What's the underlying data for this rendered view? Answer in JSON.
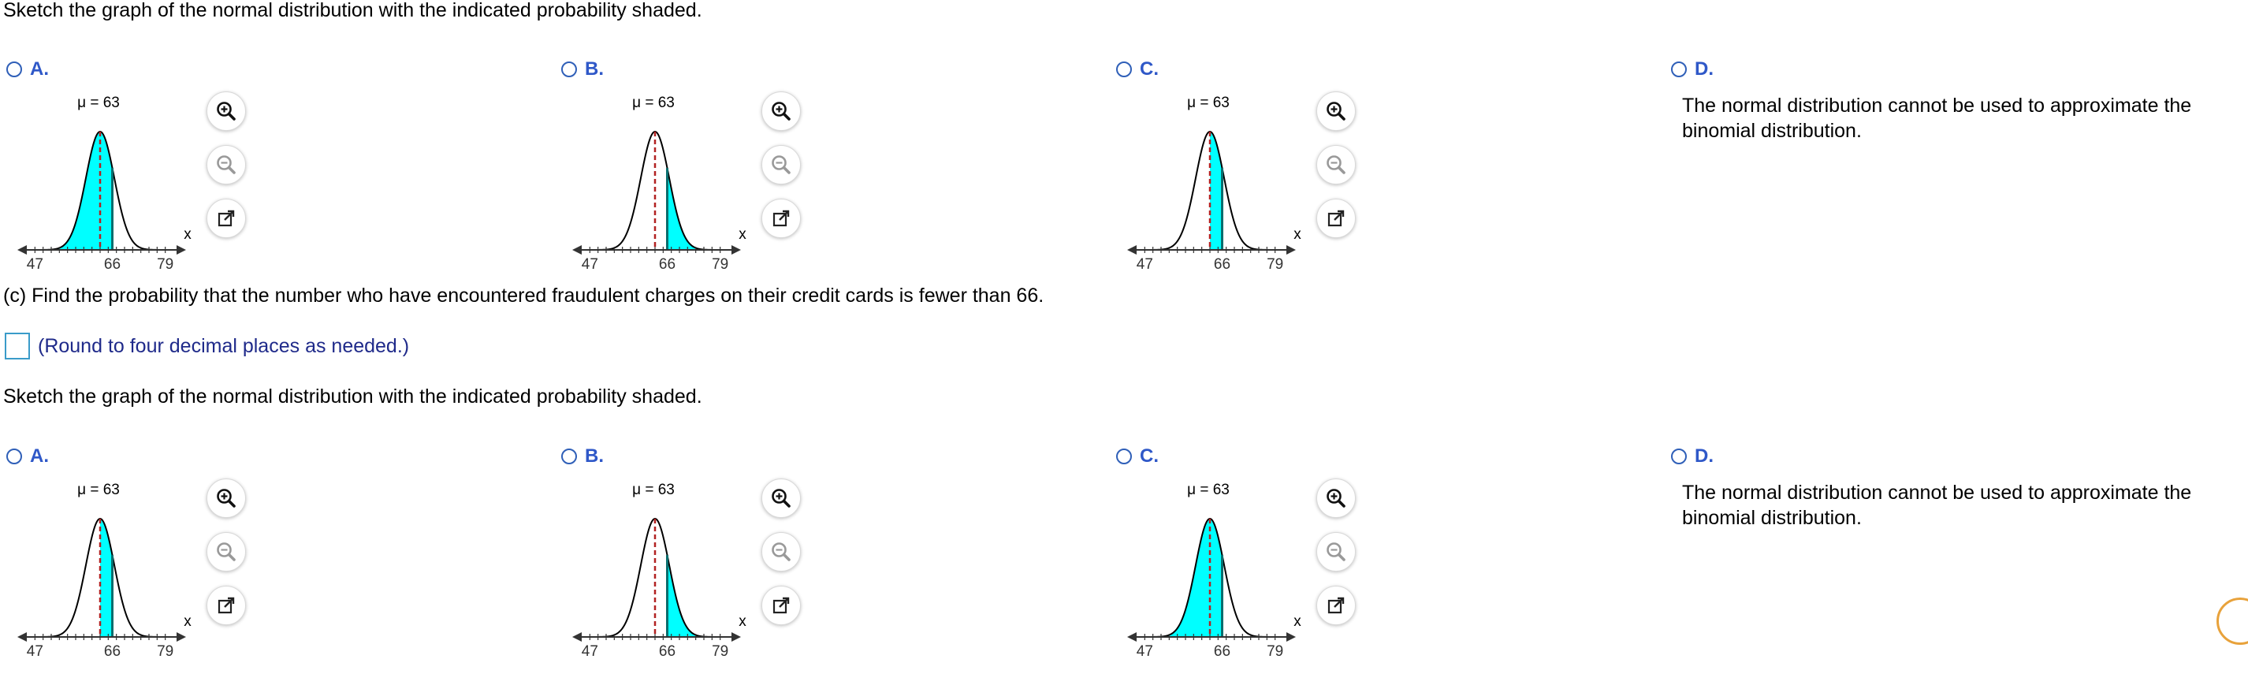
{
  "sketch_prompt_top": "Sketch the graph of the normal distribution with the indicated probability shaded.",
  "question_c": "(c) Find the probability that the number who have encountered fraudulent charges on their credit cards is fewer than 66.",
  "answer_note": "(Round to four decimal places as needed.)",
  "sketch_prompt_bottom": "Sketch the graph of the normal distribution with the indicated probability shaded.",
  "graph": {
    "mu_label": "μ = 63",
    "x_label": "x",
    "ticks": [
      "47",
      "66",
      "79"
    ],
    "mean": 63,
    "marker": 66,
    "axis_min": 45,
    "axis_max": 81,
    "shade_color": "#00ffff",
    "mean_line_color": "#b22222",
    "marker_line_color": "#0a6e6e"
  },
  "set1": {
    "options": [
      {
        "letter": "A.",
        "shade": "left"
      },
      {
        "letter": "B.",
        "shade": "right"
      },
      {
        "letter": "C.",
        "shade": "between"
      }
    ],
    "d_letter": "D.",
    "d_text": "The normal distribution cannot be used to approximate the binomial distribution."
  },
  "set2": {
    "options": [
      {
        "letter": "A.",
        "shade": "between"
      },
      {
        "letter": "B.",
        "shade": "right"
      },
      {
        "letter": "C.",
        "shade": "left"
      }
    ],
    "d_letter": "D.",
    "d_text": "The normal distribution cannot be used to approximate the binomial distribution."
  },
  "icons": {
    "zoom_in": "zoom-in-icon",
    "zoom_out": "zoom-out-icon",
    "popout": "popout-icon"
  }
}
